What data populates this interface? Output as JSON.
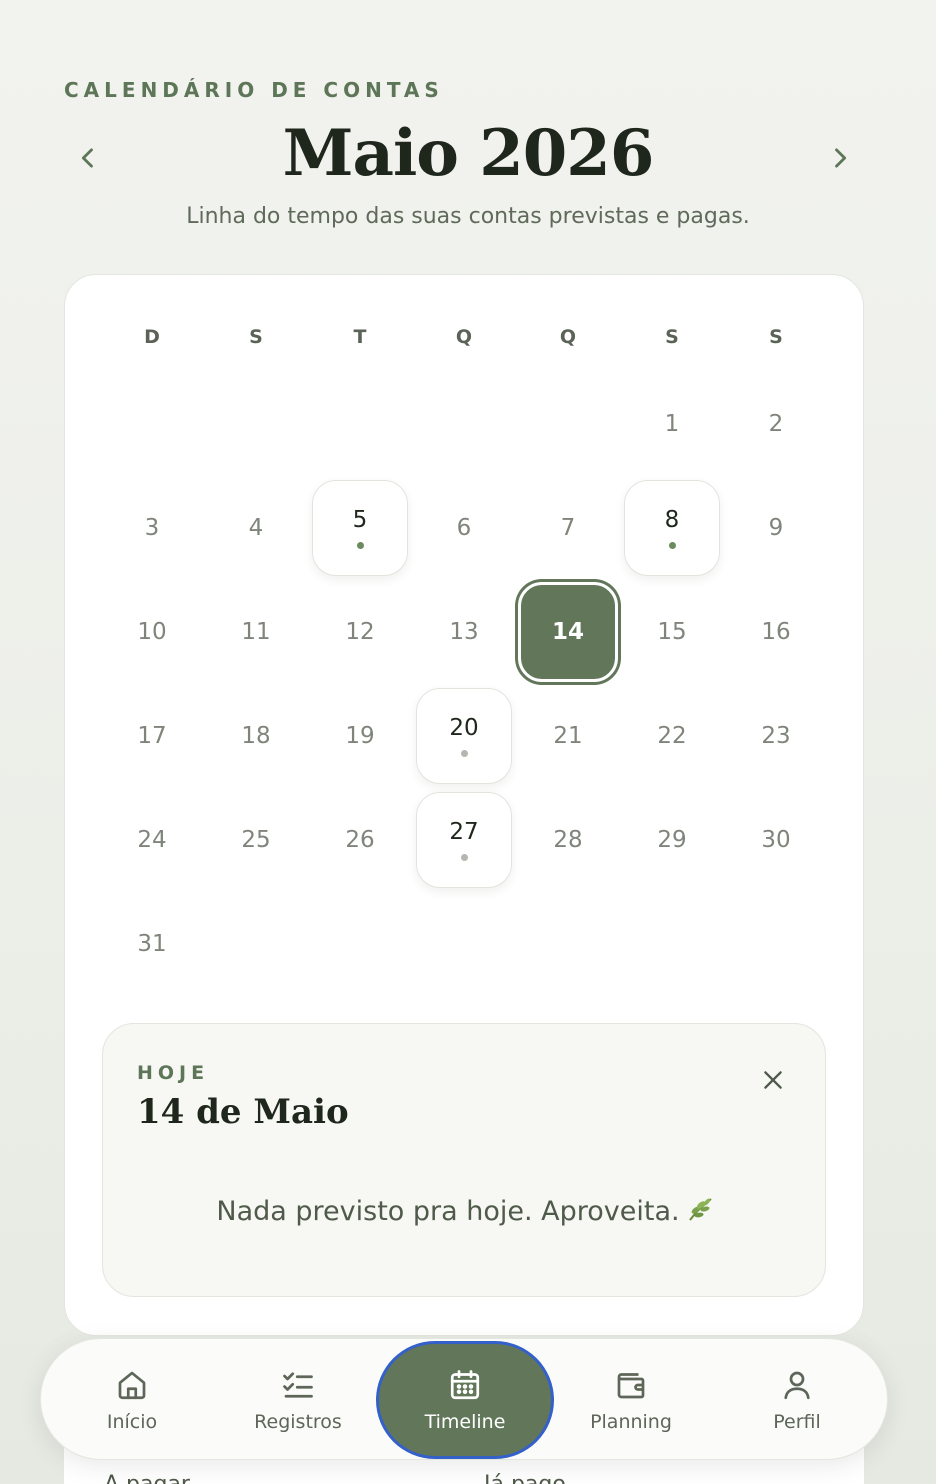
{
  "header": {
    "eyebrow": "CALENDÁRIO DE CONTAS",
    "month_title": "Maio 2026",
    "subtitle": "Linha do tempo das suas contas previstas e pagas.",
    "prev_icon": "chevron-left-icon",
    "next_icon": "chevron-right-icon"
  },
  "calendar": {
    "weekdays": [
      "D",
      "S",
      "T",
      "Q",
      "Q",
      "S",
      "S"
    ],
    "days": [
      {
        "label": "1",
        "col": 5,
        "row": 0
      },
      {
        "label": "2",
        "col": 6,
        "row": 0
      },
      {
        "label": "3",
        "col": 0,
        "row": 1
      },
      {
        "label": "4",
        "col": 1,
        "row": 1
      },
      {
        "label": "5",
        "col": 2,
        "row": 1,
        "event": "green"
      },
      {
        "label": "6",
        "col": 3,
        "row": 1
      },
      {
        "label": "7",
        "col": 4,
        "row": 1
      },
      {
        "label": "8",
        "col": 5,
        "row": 1,
        "event": "green"
      },
      {
        "label": "9",
        "col": 6,
        "row": 1
      },
      {
        "label": "10",
        "col": 0,
        "row": 2
      },
      {
        "label": "11",
        "col": 1,
        "row": 2
      },
      {
        "label": "12",
        "col": 2,
        "row": 2
      },
      {
        "label": "13",
        "col": 3,
        "row": 2
      },
      {
        "label": "14",
        "col": 4,
        "row": 2,
        "today": true
      },
      {
        "label": "15",
        "col": 5,
        "row": 2
      },
      {
        "label": "16",
        "col": 6,
        "row": 2
      },
      {
        "label": "17",
        "col": 0,
        "row": 3
      },
      {
        "label": "18",
        "col": 1,
        "row": 3
      },
      {
        "label": "19",
        "col": 2,
        "row": 3
      },
      {
        "label": "20",
        "col": 3,
        "row": 3,
        "event": "gray"
      },
      {
        "label": "21",
        "col": 4,
        "row": 3
      },
      {
        "label": "22",
        "col": 5,
        "row": 3
      },
      {
        "label": "23",
        "col": 6,
        "row": 3
      },
      {
        "label": "24",
        "col": 0,
        "row": 4
      },
      {
        "label": "25",
        "col": 1,
        "row": 4
      },
      {
        "label": "26",
        "col": 2,
        "row": 4
      },
      {
        "label": "27",
        "col": 3,
        "row": 4,
        "event": "gray"
      },
      {
        "label": "28",
        "col": 4,
        "row": 4
      },
      {
        "label": "29",
        "col": 5,
        "row": 4
      },
      {
        "label": "30",
        "col": 6,
        "row": 4
      },
      {
        "label": "31",
        "col": 0,
        "row": 5
      }
    ]
  },
  "today_panel": {
    "eyebrow": "HOJE",
    "title": "14 de Maio",
    "empty_message": "Nada previsto pra hoje. Aproveita.",
    "close_icon": "close-icon",
    "emoji_icon": "herb-leaf-icon"
  },
  "below": {
    "left_label": "A pagar",
    "right_label": "Já pago"
  },
  "bottom_nav": {
    "items": [
      {
        "label": "Início",
        "icon": "home-icon"
      },
      {
        "label": "Registros",
        "icon": "checklist-icon"
      },
      {
        "label": "Timeline",
        "icon": "calendar-icon",
        "active": true
      },
      {
        "label": "Planning",
        "icon": "wallet-icon"
      },
      {
        "label": "Perfil",
        "icon": "user-icon"
      }
    ]
  },
  "colors": {
    "accent": "#62775a",
    "event_green": "#6b8a5e",
    "event_gray": "#b4b7b0",
    "focus_ring": "#3460c9"
  }
}
